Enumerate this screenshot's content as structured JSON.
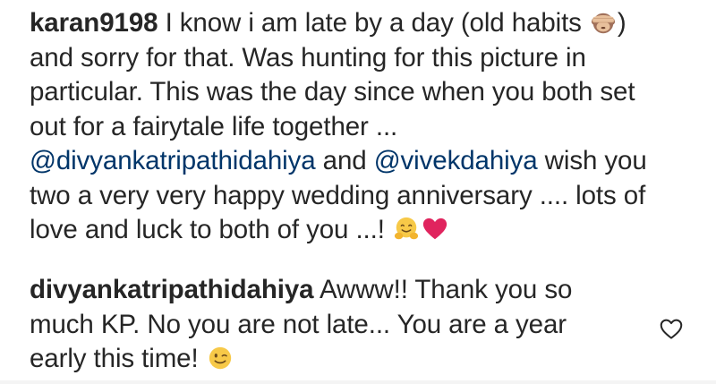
{
  "comments": [
    {
      "username": "karan9198",
      "lines": [
        {
          "t1": "I know i am late by a day (old habits ",
          "t2": ")"
        },
        {
          "t1": "and sorry for that. Was hunting for this picture in"
        },
        {
          "t1": "particular. This was the day since when you both set"
        },
        {
          "t1": "out for a fairytale life together ..."
        },
        {
          "mention1": "@divyankatripathidahiya",
          "t1": " and ",
          "mention2": "@vivekdahiya",
          "t2": " wish you"
        },
        {
          "t1": "two a very very happy wedding anniversary .... lots of"
        },
        {
          "t1": "love and luck to both of you ...! "
        }
      ],
      "emojis": [
        "see-no-evil-monkey-icon",
        "hugging-face-icon",
        "red-heart-icon"
      ]
    },
    {
      "username": "divyankatripathidahiya",
      "lines": [
        {
          "t1": " Awww!! Thank you so"
        },
        {
          "t1": "much KP. No you are not late... You are a year"
        },
        {
          "t1": "early this time! "
        }
      ],
      "emojis": [
        "winking-face-icon"
      ],
      "like_icon": "heart-outline-icon"
    }
  ],
  "colors": {
    "text": "#262626",
    "mention": "#003569",
    "heart": "#e0245e"
  }
}
